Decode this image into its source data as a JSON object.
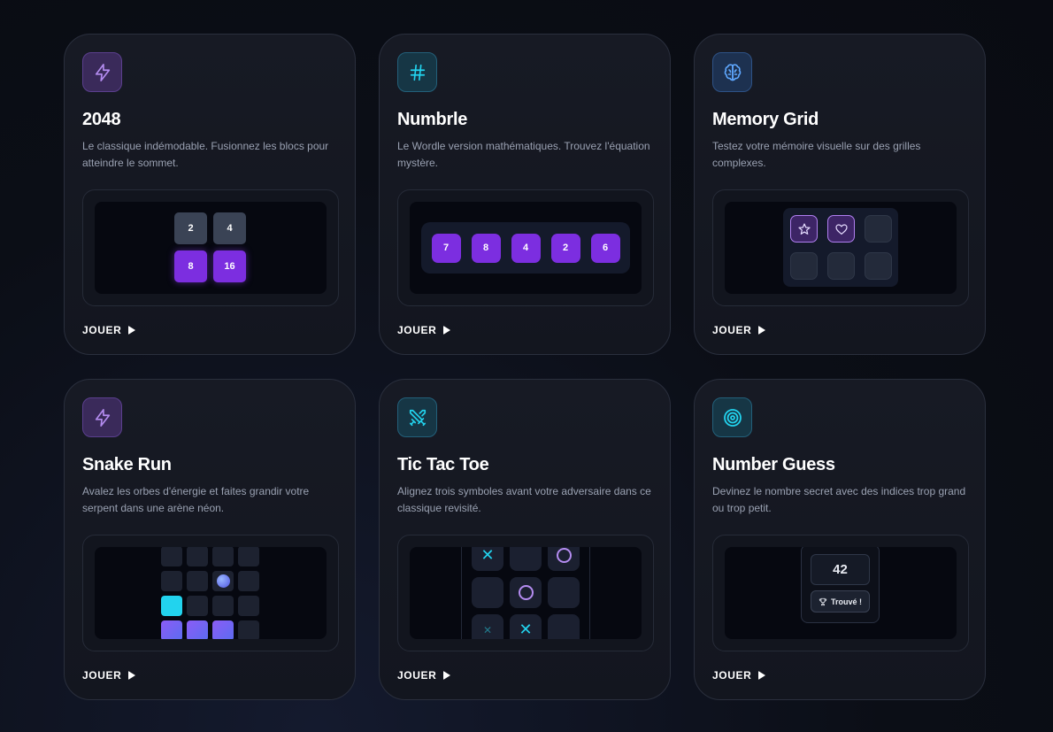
{
  "play_label": "JOUER",
  "colors": {
    "accent_purple": "#7c2ee0",
    "accent_cyan": "#22d3ee",
    "background": "#0b0e16"
  },
  "games": [
    {
      "title": "2048",
      "description": "Le classique indémodable. Fusionnez les blocs pour atteindre le sommet.",
      "icon": "lightning-icon",
      "tiles": [
        "2",
        "4",
        "8",
        "16"
      ]
    },
    {
      "title": "Numbrle",
      "description": "Le Wordle version mathématiques. Trouvez l'équation mystère.",
      "icon": "hash-icon",
      "tiles": [
        "7",
        "8",
        "4",
        "2",
        "6"
      ]
    },
    {
      "title": "Memory Grid",
      "description": "Testez votre mémoire visuelle sur des grilles complexes.",
      "icon": "brain-icon",
      "revealed_cards": [
        "star-icon",
        "heart-icon"
      ]
    },
    {
      "title": "Snake Run",
      "description": "Avalez les orbes d'énergie et faites grandir votre serpent dans une arène néon.",
      "icon": "lightning-icon"
    },
    {
      "title": "Tic Tac Toe",
      "description": "Alignez trois symboles avant votre adversaire dans ce classique revisité.",
      "icon": "crossed-swords-icon",
      "marks": [
        "x",
        "o",
        "x",
        "x"
      ]
    },
    {
      "title": "Number Guess",
      "description": "Devinez le nombre secret avec des indices trop grand ou trop petit.",
      "icon": "target-icon",
      "number": "42",
      "badge": "Trouvé !"
    }
  ]
}
